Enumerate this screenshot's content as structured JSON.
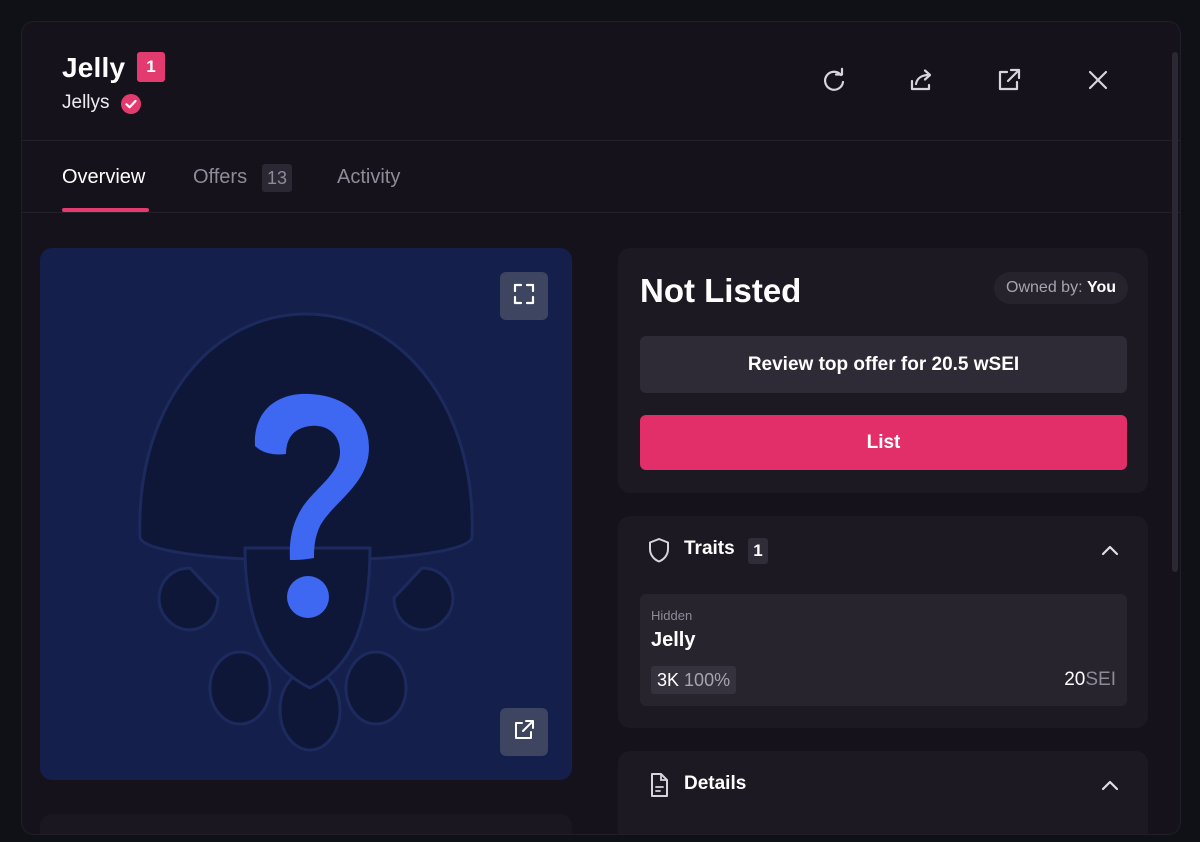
{
  "header": {
    "title": "Jelly",
    "badge": "1",
    "collection": "Jellys",
    "actions": [
      "refresh-icon",
      "share-icon",
      "external-link-icon",
      "close-icon"
    ]
  },
  "tabs": [
    {
      "label": "Overview",
      "active": true
    },
    {
      "label": "Offers",
      "count": "13",
      "active": false
    },
    {
      "label": "Activity",
      "active": false
    }
  ],
  "media": {
    "icons": [
      "fullscreen-icon",
      "external-link-icon"
    ]
  },
  "listing": {
    "status": "Not Listed",
    "owner_label": "Owned by:",
    "owner_value": "You",
    "offer_button": "Review top offer for 20.5 wSEI",
    "list_button": "List"
  },
  "traits": {
    "title": "Traits",
    "count": "1",
    "items": [
      {
        "type": "Hidden",
        "value": "Jelly",
        "count": "3K",
        "percent": "100%",
        "price": "20",
        "unit": "SEI"
      }
    ]
  },
  "details": {
    "title": "Details"
  },
  "colors": {
    "accent": "#e33b6f",
    "background": "#15121b",
    "card": "#1c1922",
    "image_bg": "#141f4c"
  }
}
